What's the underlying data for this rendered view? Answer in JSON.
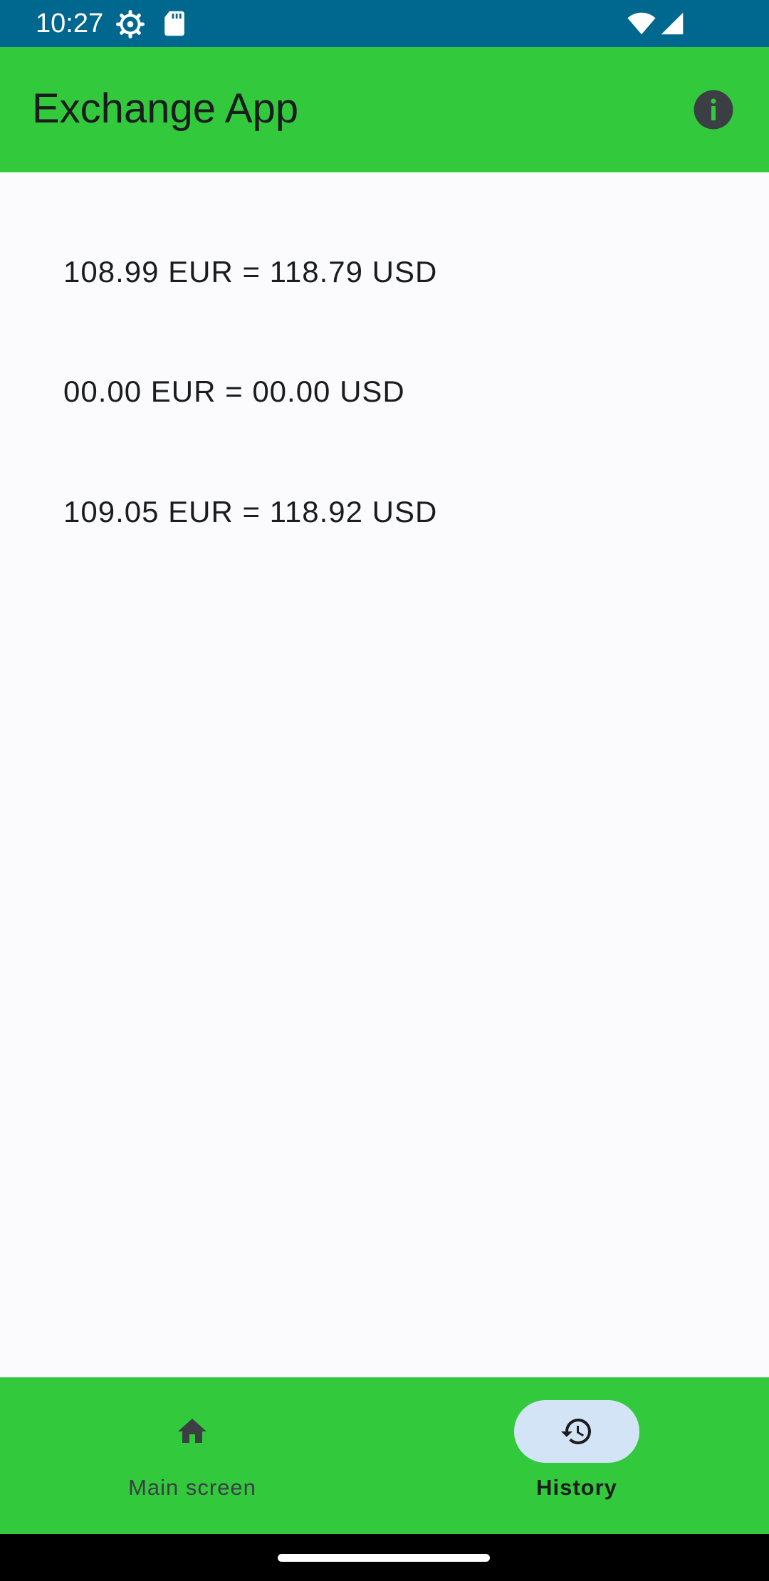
{
  "status_bar": {
    "time": "10:27",
    "icons": [
      "settings-gear-icon",
      "sd-card-icon",
      "wifi-icon",
      "signal-icon"
    ]
  },
  "app_bar": {
    "title": "Exchange App",
    "info_icon": "info-icon"
  },
  "history": {
    "items": [
      "108.99 EUR = 118.79 USD",
      "00.00 EUR = 00.00 USD",
      "109.05 EUR = 118.92 USD"
    ]
  },
  "bottom_nav": {
    "items": [
      {
        "label": "Main screen",
        "icon": "home-icon",
        "active": false
      },
      {
        "label": "History",
        "icon": "history-icon",
        "active": true
      }
    ]
  },
  "colors": {
    "status_bar": "#00678f",
    "primary": "#33c93d",
    "background": "#fbfbfe",
    "active_indicator": "#d2e4f6",
    "text": "#1a1c1e"
  }
}
